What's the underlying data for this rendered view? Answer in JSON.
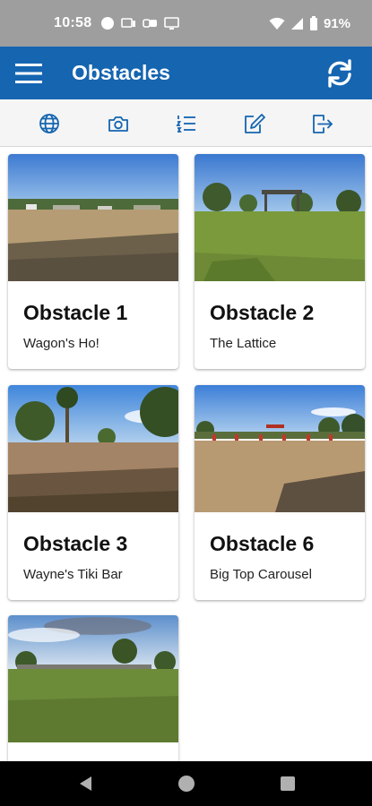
{
  "status_bar": {
    "time": "10:58",
    "battery": "91%",
    "icons": [
      "circle-notification-icon",
      "media-cast-icon",
      "link-icon",
      "screen-icon",
      "wifi-icon",
      "signal-icon",
      "battery-icon"
    ]
  },
  "app_bar": {
    "title": "Obstacles",
    "menu_icon": "hamburger-menu-icon",
    "sync_icon": "sync-icon",
    "color": "#1565b0"
  },
  "toolbar": {
    "items": [
      {
        "icon": "globe-icon"
      },
      {
        "icon": "camera-icon"
      },
      {
        "icon": "list-icon"
      },
      {
        "icon": "edit-icon"
      },
      {
        "icon": "logout-icon"
      }
    ],
    "icon_color": "#1565b0"
  },
  "cards": [
    {
      "title": "Obstacle 1",
      "subtitle": "Wagon's Ho!"
    },
    {
      "title": "Obstacle 2",
      "subtitle": "The Lattice"
    },
    {
      "title": "Obstacle 3",
      "subtitle": "Wayne's Tiki Bar"
    },
    {
      "title": "Obstacle 6",
      "subtitle": "Big Top Carousel"
    },
    {
      "title": "",
      "subtitle": ""
    }
  ],
  "nav_bar": {
    "buttons": [
      "back-icon",
      "home-icon",
      "recents-icon"
    ]
  }
}
